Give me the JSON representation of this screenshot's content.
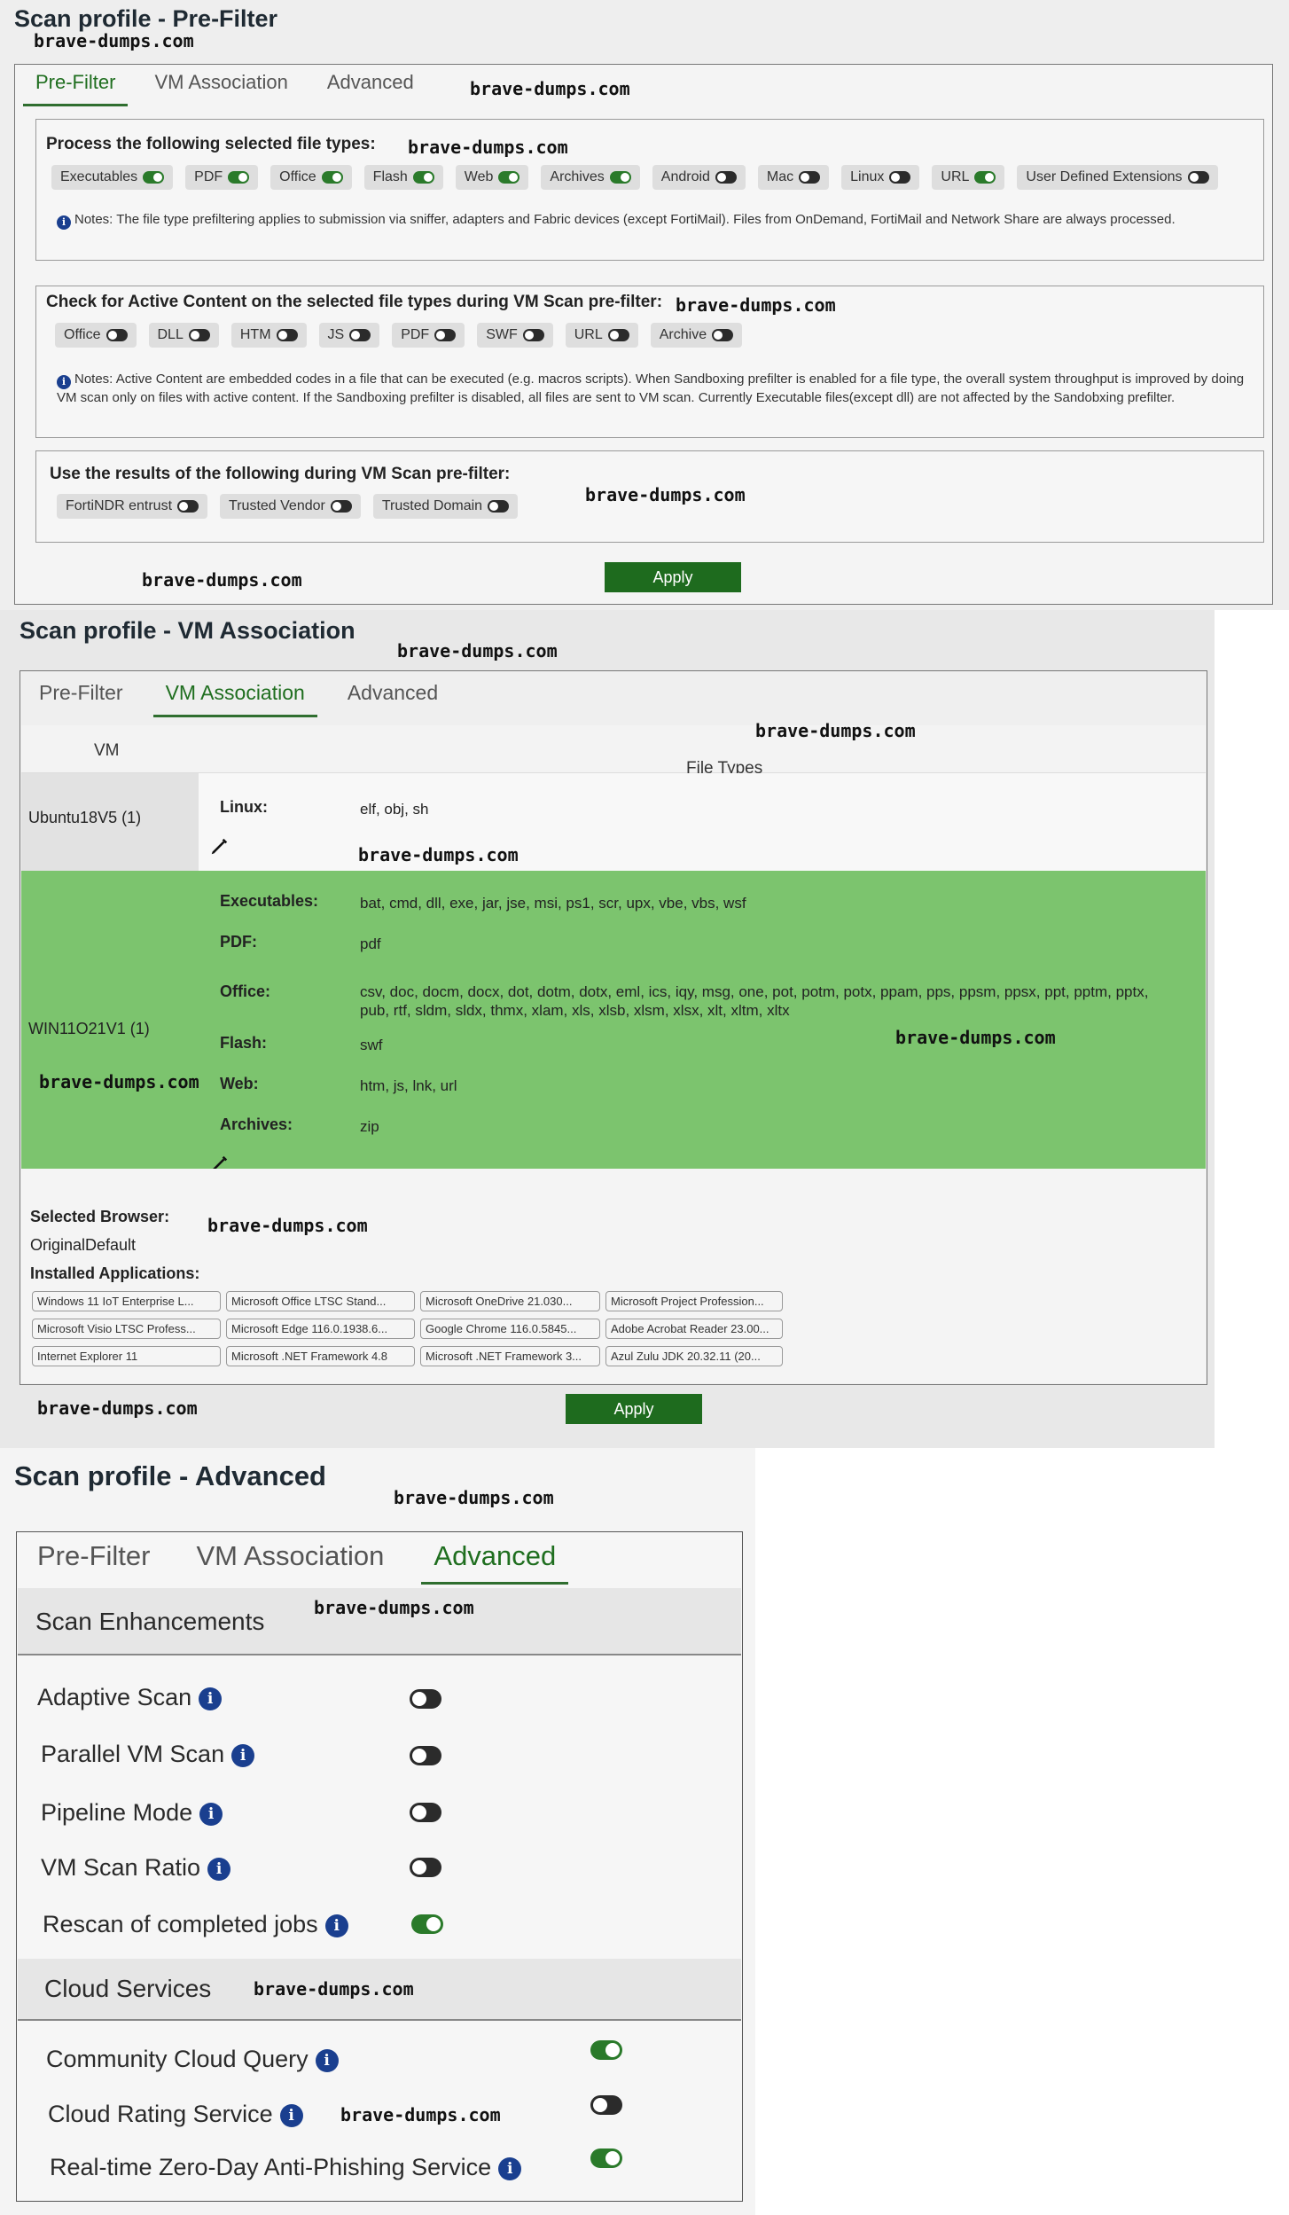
{
  "watermark": "brave-dumps.com",
  "prefilter": {
    "title": "Scan profile - Pre-Filter",
    "tabs": [
      "Pre-Filter",
      "VM Association",
      "Advanced"
    ],
    "active_tab": 0,
    "file_types": {
      "title": "Process the following selected file types:",
      "items": [
        {
          "label": "Executables",
          "on": true
        },
        {
          "label": "PDF",
          "on": true
        },
        {
          "label": "Office",
          "on": true
        },
        {
          "label": "Flash",
          "on": true
        },
        {
          "label": "Web",
          "on": true
        },
        {
          "label": "Archives",
          "on": true
        },
        {
          "label": "Android",
          "on": false
        },
        {
          "label": "Mac",
          "on": false
        },
        {
          "label": "Linux",
          "on": false
        },
        {
          "label": "URL",
          "on": true
        },
        {
          "label": "User Defined Extensions",
          "on": false
        }
      ],
      "note": "Notes: The file type prefiltering applies to submission via sniffer, adapters and Fabric devices (except FortiMail). Files from OnDemand, FortiMail and Network Share are always processed."
    },
    "active_content": {
      "title": "Check for Active Content on the selected file types during VM Scan pre-filter:",
      "items": [
        {
          "label": "Office",
          "on": false
        },
        {
          "label": "DLL",
          "on": false
        },
        {
          "label": "HTM",
          "on": false
        },
        {
          "label": "JS",
          "on": false
        },
        {
          "label": "PDF",
          "on": false
        },
        {
          "label": "SWF",
          "on": false
        },
        {
          "label": "URL",
          "on": false
        },
        {
          "label": "Archive",
          "on": false
        }
      ],
      "note": "Notes: Active Content are embedded codes in a file that can be executed (e.g. macros scripts). When Sandboxing prefilter is enabled for a file type, the overall system throughput is improved by doing VM scan only on files with active content. If the Sandboxing prefilter is disabled, all files are sent to VM scan. Currently Executable files(except dll) are not affected by the Sandobxing prefilter."
    },
    "results": {
      "title": "Use the results of the following during VM Scan pre-filter:",
      "items": [
        {
          "label": "FortiNDR entrust",
          "on": false
        },
        {
          "label": "Trusted Vendor",
          "on": false
        },
        {
          "label": "Trusted Domain",
          "on": false
        }
      ]
    },
    "apply_label": "Apply"
  },
  "vm_association": {
    "title": "Scan profile - VM Association",
    "tabs": [
      "Pre-Filter",
      "VM Association",
      "Advanced"
    ],
    "active_tab": 1,
    "col_vm": "VM",
    "col_file_types": "File Types",
    "rows": [
      {
        "vm": "Ubuntu18V5 (1)",
        "types": [
          {
            "label": "Linux:",
            "value": "elf, obj, sh"
          }
        ]
      },
      {
        "vm": "WIN11O21V1 (1)",
        "types": [
          {
            "label": "Executables:",
            "value": "bat, cmd, dll, exe, jar, jse, msi, ps1, scr, upx, vbe, vbs, wsf"
          },
          {
            "label": "PDF:",
            "value": "pdf"
          },
          {
            "label": "Office:",
            "value": "csv, doc, docm, docx, dot, dotm, dotx, eml, ics, iqy, msg, one, pot, potm, potx, ppam, pps, ppsm, ppsx, ppt, pptm, pptx, pub, rtf, sldm, sldx, thmx, xlam, xls, xlsb, xlsm, xlsx, xlt, xltm, xltx"
          },
          {
            "label": "Flash:",
            "value": "swf"
          },
          {
            "label": "Web:",
            "value": "htm, js, lnk, url"
          },
          {
            "label": "Archives:",
            "value": "zip"
          }
        ]
      }
    ],
    "selected_browser_label": "Selected Browser:",
    "selected_browser_value": "OriginalDefault",
    "installed_apps_label": "Installed Applications:",
    "apps": [
      "Windows 11 IoT Enterprise L...",
      "Microsoft Office LTSC Stand...",
      "Microsoft OneDrive 21.030...",
      "Microsoft Project Profession...",
      "Microsoft Visio LTSC Profess...",
      "Microsoft Edge 116.0.1938.6...",
      "Google Chrome 116.0.5845...",
      "Adobe Acrobat Reader 23.00...",
      "Internet Explorer 11",
      "Microsoft .NET Framework 4.8",
      "Microsoft .NET Framework 3...",
      "Azul Zulu JDK 20.32.11 (20..."
    ],
    "apply_label": "Apply"
  },
  "advanced": {
    "title": "Scan profile - Advanced",
    "tabs": [
      "Pre-Filter",
      "VM Association",
      "Advanced"
    ],
    "active_tab": 2,
    "scan_enhancements": {
      "title": "Scan Enhancements",
      "items": [
        {
          "label": "Adaptive Scan",
          "on": false
        },
        {
          "label": "Parallel VM Scan",
          "on": false
        },
        {
          "label": "Pipeline Mode",
          "on": false
        },
        {
          "label": "VM Scan Ratio",
          "on": false
        },
        {
          "label": "Rescan of completed jobs",
          "on": true
        }
      ]
    },
    "cloud_services": {
      "title": "Cloud Services",
      "items": [
        {
          "label": "Community Cloud Query",
          "on": true
        },
        {
          "label": "Cloud Rating Service",
          "on": false
        },
        {
          "label": "Real-time Zero-Day Anti-Phishing Service",
          "on": true
        }
      ]
    }
  }
}
